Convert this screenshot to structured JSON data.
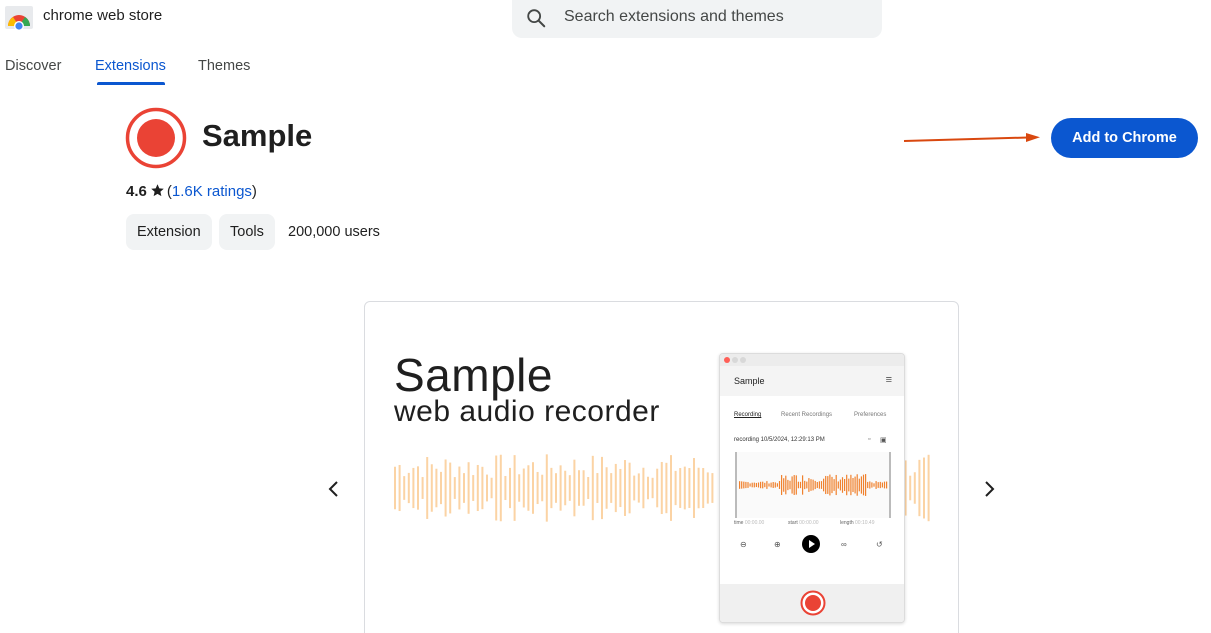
{
  "header": {
    "brand": "chrome web store",
    "search_placeholder": "Search extensions and themes"
  },
  "nav": {
    "tabs": [
      {
        "label": "Discover",
        "active": false
      },
      {
        "label": "Extensions",
        "active": true
      },
      {
        "label": "Themes",
        "active": false
      }
    ]
  },
  "extension": {
    "name": "Sample",
    "rating": "4.6",
    "ratings_count": "1.6K ratings",
    "chips": [
      "Extension",
      "Tools"
    ],
    "users": "200,000 users",
    "add_button": "Add to Chrome"
  },
  "screenshot": {
    "title": "Sample",
    "subtitle": "web audio recorder",
    "app": {
      "title": "Sample",
      "tabs": [
        "Recording",
        "Recent Recordings",
        "Preferences"
      ],
      "recording_label": "recording 10/5/2024, 12:29:13 PM",
      "time_label": "time",
      "time_value": "00:00.00",
      "start_label": "start",
      "start_value": "00:00.00",
      "length_label": "length",
      "length_value": "00:10.49"
    }
  },
  "colors": {
    "accent": "#0b57d0",
    "record_red": "#ea4335",
    "wave_orange": "#f0812d",
    "wave_light": "#fbd3a4",
    "arrow": "#d9480f"
  }
}
